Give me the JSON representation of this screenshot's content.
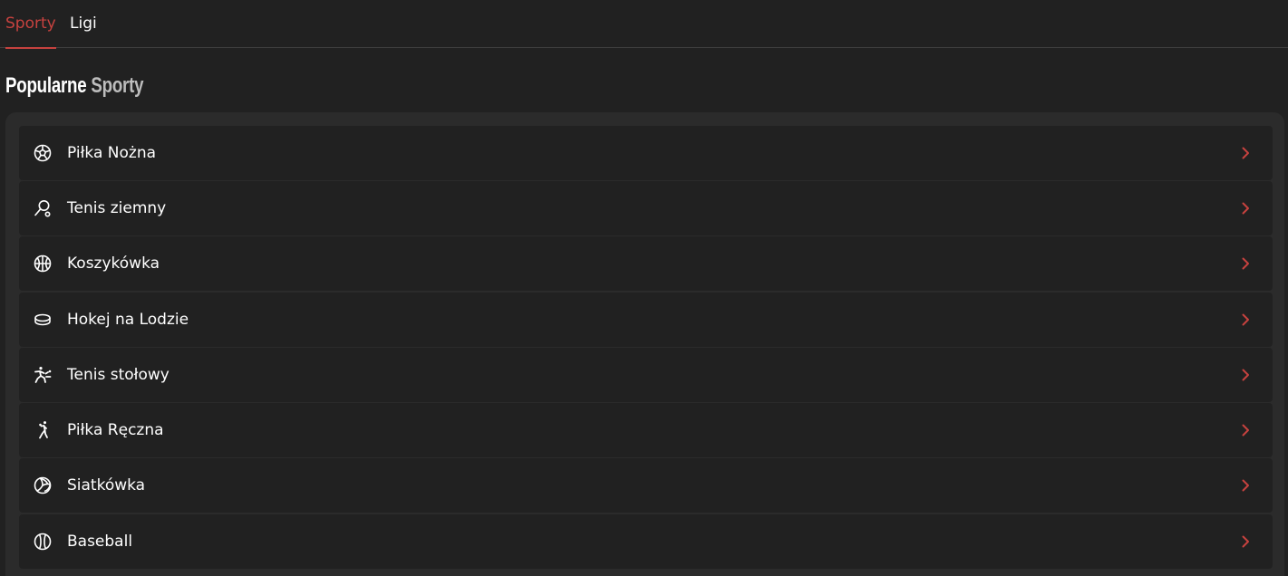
{
  "tabs": [
    {
      "label": "Sporty",
      "active": true
    },
    {
      "label": "Ligi",
      "active": false
    }
  ],
  "heading": {
    "part1": "Popularne",
    "part2": "Sporty"
  },
  "sports": [
    {
      "label": "Piłka Nożna",
      "icon": "soccer-ball-icon"
    },
    {
      "label": "Tenis ziemny",
      "icon": "tennis-racket-icon"
    },
    {
      "label": "Koszykówka",
      "icon": "basketball-icon"
    },
    {
      "label": "Hokej na Lodzie",
      "icon": "hockey-puck-icon"
    },
    {
      "label": "Tenis stołowy",
      "icon": "table-tennis-player-icon"
    },
    {
      "label": "Piłka Ręczna",
      "icon": "handball-player-icon"
    },
    {
      "label": "Siatkówka",
      "icon": "volleyball-icon"
    },
    {
      "label": "Baseball",
      "icon": "baseball-icon"
    }
  ],
  "colors": {
    "accent": "#c7423f",
    "background": "#212121",
    "panel": "#2b2b2b",
    "heading_secondary": "#bdbdbd"
  }
}
